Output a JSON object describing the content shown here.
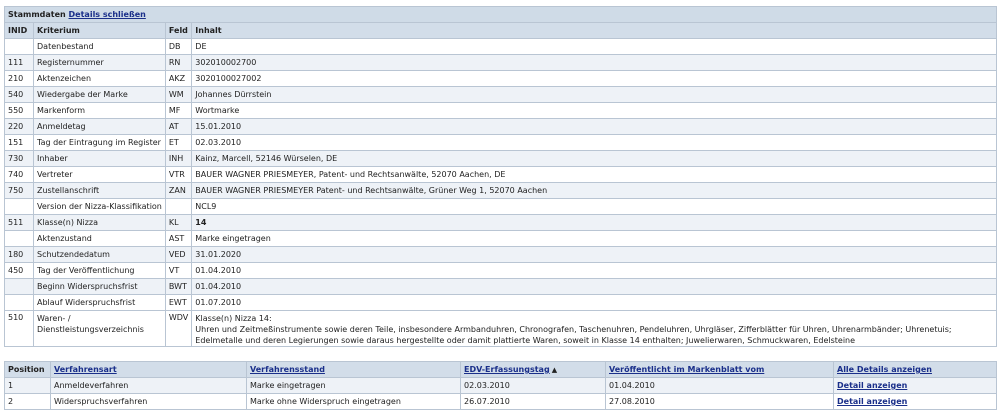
{
  "stammdaten": {
    "title": "Stammdaten",
    "toggle_link": "Details schließen",
    "columns": [
      "INID",
      "Kriterium",
      "Feld",
      "Inhalt"
    ],
    "rows": [
      {
        "inid": "",
        "kriterium": "Datenbestand",
        "feld": "DB",
        "inhalt": "DE"
      },
      {
        "inid": "111",
        "kriterium": "Registernummer",
        "feld": "RN",
        "inhalt": "302010002700"
      },
      {
        "inid": "210",
        "kriterium": "Aktenzeichen",
        "feld": "AKZ",
        "inhalt": "3020100027002"
      },
      {
        "inid": "540",
        "kriterium": "Wiedergabe der Marke",
        "feld": "WM",
        "inhalt": "Johannes Dürrstein"
      },
      {
        "inid": "550",
        "kriterium": "Markenform",
        "feld": "MF",
        "inhalt": "Wortmarke"
      },
      {
        "inid": "220",
        "kriterium": "Anmeldetag",
        "feld": "AT",
        "inhalt": "15.01.2010"
      },
      {
        "inid": "151",
        "kriterium": "Tag der Eintragung im Register",
        "feld": "ET",
        "inhalt": "02.03.2010"
      },
      {
        "inid": "730",
        "kriterium": "Inhaber",
        "feld": "INH",
        "inhalt": "Kainz, Marcell, 52146 Würselen, DE"
      },
      {
        "inid": "740",
        "kriterium": "Vertreter",
        "feld": "VTR",
        "inhalt": "BAUER WAGNER PRIESMEYER, Patent- und Rechtsanwälte, 52070 Aachen, DE"
      },
      {
        "inid": "750",
        "kriterium": "Zustellanschrift",
        "feld": "ZAN",
        "inhalt": "BAUER WAGNER PRIESMEYER Patent- und Rechtsanwälte, Grüner Weg 1, 52070 Aachen"
      },
      {
        "inid": "",
        "kriterium": "Version der Nizza-Klassifikation",
        "feld": "",
        "inhalt": "NCL9"
      },
      {
        "inid": "511",
        "kriterium": "Klasse(n) Nizza",
        "feld": "KL",
        "inhalt": "14"
      },
      {
        "inid": "",
        "kriterium": "Aktenzustand",
        "feld": "AST",
        "inhalt": "Marke eingetragen"
      },
      {
        "inid": "180",
        "kriterium": "Schutzendedatum",
        "feld": "VED",
        "inhalt": "31.01.2020"
      },
      {
        "inid": "450",
        "kriterium": "Tag der Veröffentlichung",
        "feld": "VT",
        "inhalt": "01.04.2010"
      },
      {
        "inid": "",
        "kriterium": "Beginn Widerspruchsfrist",
        "feld": "BWT",
        "inhalt": "01.04.2010"
      },
      {
        "inid": "",
        "kriterium": "Ablauf Widerspruchsfrist",
        "feld": "EWT",
        "inhalt": "01.07.2010"
      }
    ],
    "wdv": {
      "inid": "510",
      "kriterium_line1": "Waren- /",
      "kriterium_line2": "Dienstleistungsverzeichnis",
      "feld": "WDV",
      "inhalt_line1": "Klasse(n) Nizza 14:",
      "inhalt_line2": "Uhren und Zeitmeßinstrumente sowie deren Teile, insbesondere Armbanduhren, Chronografen, Taschenuhren, Pendeluhren, Uhrgläser, Zifferblätter für Uhren, Uhrenarmbänder; Uhrenetuis; Edelmetalle und deren Legierungen sowie daraus hergestellte oder damit plattierte Waren, soweit in Klasse 14 enthalten; Juwelierwaren, Schmuckwaren, Edelsteine"
    }
  },
  "verfahren": {
    "columns": {
      "position": "Position",
      "art": "Verfahrensart",
      "stand": "Verfahrensstand",
      "edv": "EDV-Erfassungstag",
      "veroeff": "Veröffentlicht im Markenblatt vom",
      "details": "Alle Details anzeigen"
    },
    "sort_indicator": "▲",
    "rows": [
      {
        "position": "1",
        "art": "Anmeldeverfahren",
        "stand": "Marke eingetragen",
        "edv": "02.03.2010",
        "veroeff": "01.04.2010",
        "detail": "Detail anzeigen"
      },
      {
        "position": "2",
        "art": "Widerspruchsverfahren",
        "stand": "Marke ohne Widerspruch eingetragen",
        "edv": "26.07.2010",
        "veroeff": "27.08.2010",
        "detail": "Detail anzeigen"
      }
    ]
  }
}
